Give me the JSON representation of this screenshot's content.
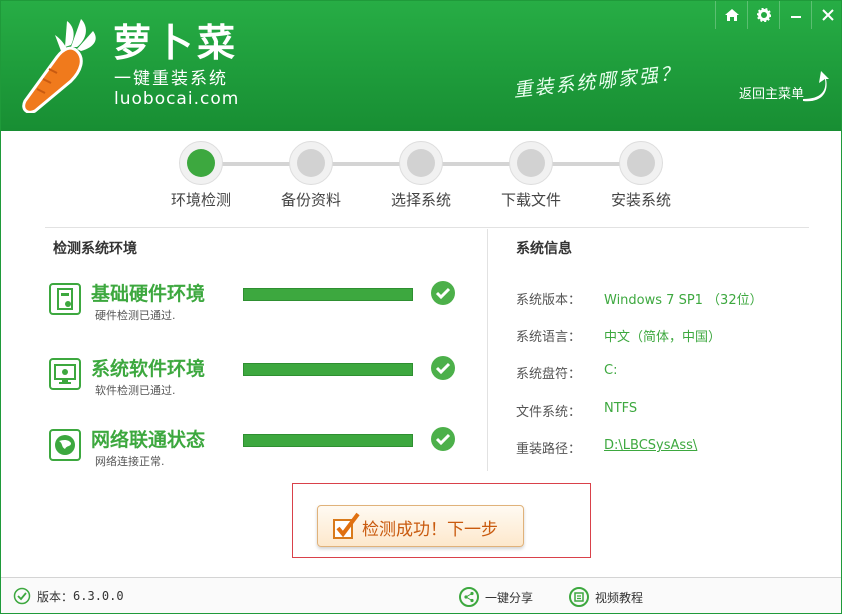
{
  "header": {
    "logo_title": "萝卜菜",
    "logo_subtitle": "一键重装系统",
    "logo_url": "luobocai.com",
    "slogan": "重装系统哪家强？",
    "back_main_label": "返回主菜单",
    "window_controls": [
      "home-icon",
      "gear-icon",
      "minimize-icon",
      "close-icon"
    ]
  },
  "steps": [
    {
      "label": "环境检测",
      "active": true
    },
    {
      "label": "备份资料",
      "active": false
    },
    {
      "label": "选择系统",
      "active": false
    },
    {
      "label": "下载文件",
      "active": false
    },
    {
      "label": "安装系统",
      "active": false
    }
  ],
  "left_panel": {
    "title": "检测系统环境",
    "checks": [
      {
        "title": "基础硬件环境",
        "sub": "硬件检测已通过.",
        "icon": "hardware-icon",
        "progress": 1.0
      },
      {
        "title": "系统软件环境",
        "sub": "软件检测已通过.",
        "icon": "software-icon",
        "progress": 1.0
      },
      {
        "title": "网络联通状态",
        "sub": "网络连接正常.",
        "icon": "network-icon",
        "progress": 1.0
      }
    ]
  },
  "right_panel": {
    "title": "系统信息",
    "rows": [
      {
        "key": "系统版本：",
        "value": "Windows 7 SP1 （32位）"
      },
      {
        "key": "系统语言：",
        "value": "中文（简体，中国）"
      },
      {
        "key": "系统盘符：",
        "value": "C:"
      },
      {
        "key": "文件系统：",
        "value": "NTFS"
      },
      {
        "key": "重装路径：",
        "value": "D:\\LBCSysAss\\"
      }
    ]
  },
  "next_button": {
    "label": "检测成功！下一步"
  },
  "footer": {
    "version_label": "版本：",
    "version": "6.3.0.0",
    "share_label": "一键分享",
    "tutorial_label": "视频教程"
  },
  "colors": {
    "brand_green": "#1e9c3b",
    "accent_green": "#3da83f",
    "button_orange": "#c95a0e",
    "highlight_red": "#d9414a"
  }
}
